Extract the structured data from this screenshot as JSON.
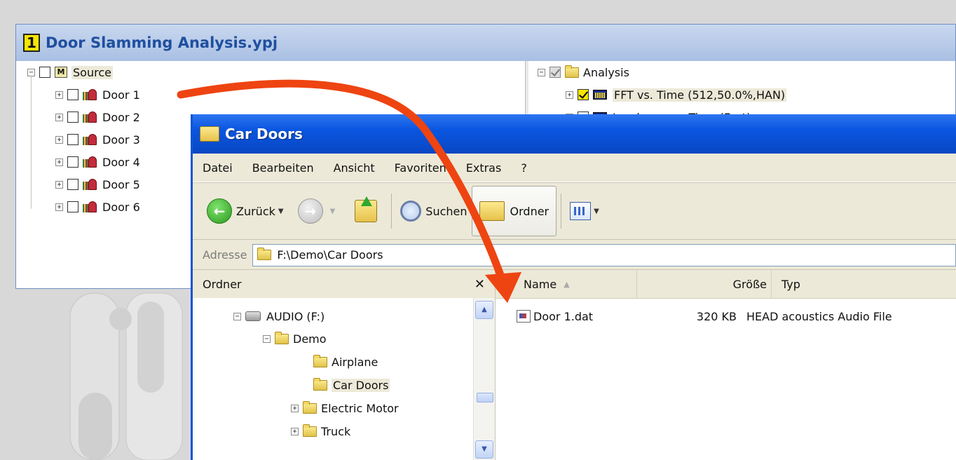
{
  "project_window": {
    "badge": "1",
    "title": "Door Slamming Analysis.ypj",
    "source_tree": {
      "root_icon": "M",
      "root_label": "Source",
      "items": [
        "Door 1",
        "Door 2",
        "Door 3",
        "Door 4",
        "Door 5",
        "Door 6"
      ]
    },
    "analysis_tree": {
      "root_label": "Analysis",
      "items": [
        {
          "label": "FFT vs. Time (512,50.0%,HAN)",
          "checked": true
        },
        {
          "label": "Loudness vs. Time (Fast)",
          "checked": false
        }
      ]
    }
  },
  "explorer": {
    "title": "Car Doors",
    "menu": [
      "Datei",
      "Bearbeiten",
      "Ansicht",
      "Favoriten",
      "Extras",
      "?"
    ],
    "toolbar": {
      "back_label": "Zurück",
      "search_label": "Suchen",
      "folders_label": "Ordner"
    },
    "address": {
      "label": "Adresse",
      "value": "F:\\Demo\\Car Doors"
    },
    "folders_pane": {
      "title": "Ordner",
      "close": "✕",
      "tree": {
        "drive": "AUDIO (F:)",
        "demo": "Demo",
        "airplane": "Airplane",
        "car_doors": "Car Doors",
        "electric_motor": "Electric Motor",
        "truck": "Truck"
      }
    },
    "files": {
      "columns": {
        "name": "Name",
        "size": "Größe",
        "type": "Typ"
      },
      "rows": [
        {
          "name": "Door 1.dat",
          "size": "320 KB",
          "type": "HEAD acoustics Audio File"
        }
      ]
    }
  },
  "colors": {
    "arrow": "#ee4411",
    "xp_title_blue": "#0a55e0",
    "project_title_blue": "#1f4f9f"
  }
}
